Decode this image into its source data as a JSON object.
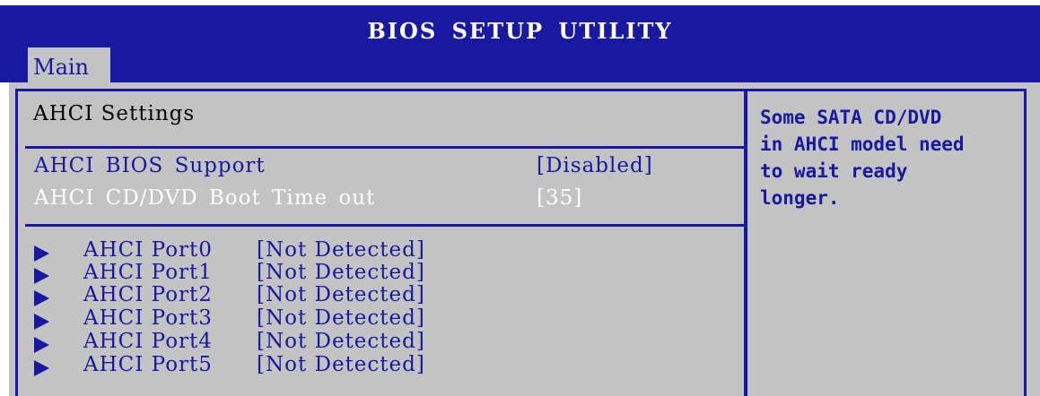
{
  "header": {
    "title": "BIOS SETUP UTILITY"
  },
  "tabs": [
    {
      "label": "Main"
    }
  ],
  "main": {
    "section_title": "AHCI Settings",
    "settings": [
      {
        "label": "AHCI BIOS Support",
        "value": "[Disabled]"
      },
      {
        "label": "AHCI CD/DVD Boot Time out",
        "value": "[35]"
      }
    ],
    "ports": [
      {
        "name": "AHCI Port0",
        "status": "[Not Detected]"
      },
      {
        "name": "AHCI Port1",
        "status": "[Not Detected]"
      },
      {
        "name": "AHCI Port2",
        "status": "[Not Detected]"
      },
      {
        "name": "AHCI Port3",
        "status": "[Not Detected]"
      },
      {
        "name": "AHCI Port4",
        "status": "[Not Detected]"
      },
      {
        "name": "AHCI Port5",
        "status": "[Not Detected]"
      }
    ]
  },
  "help": {
    "lines": [
      "Some SATA CD/DVD",
      "in AHCI model need",
      "to wait ready",
      "longer."
    ]
  },
  "colors": {
    "header_bg": "#1818a0",
    "panel_bg": "#c3c3c3",
    "text_blue": "#1818a0",
    "selected_text": "#ffffff"
  },
  "icons": {
    "port_arrow": "submenu-arrow-icon"
  }
}
